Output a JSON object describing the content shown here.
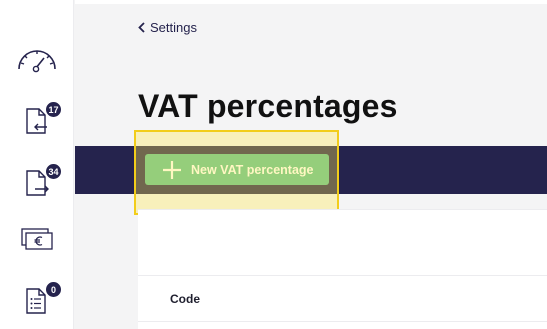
{
  "sidebar": {
    "items": [
      {
        "icon": "dashboard-gauge-icon"
      },
      {
        "icon": "incoming-document-icon",
        "badge": "17"
      },
      {
        "icon": "outgoing-document-icon",
        "badge": "34"
      },
      {
        "icon": "euro-money-icon"
      },
      {
        "icon": "checklist-document-icon",
        "badge": "0"
      }
    ]
  },
  "breadcrumb": {
    "back_label": "Settings"
  },
  "page": {
    "title": "VAT percentages"
  },
  "toolbar": {
    "new_button_label": "New VAT percentage"
  },
  "table": {
    "columns": [
      "Code"
    ]
  },
  "colors": {
    "navy": "#25234d",
    "green": "#5dc192",
    "highlight": "#f2cd1a"
  }
}
